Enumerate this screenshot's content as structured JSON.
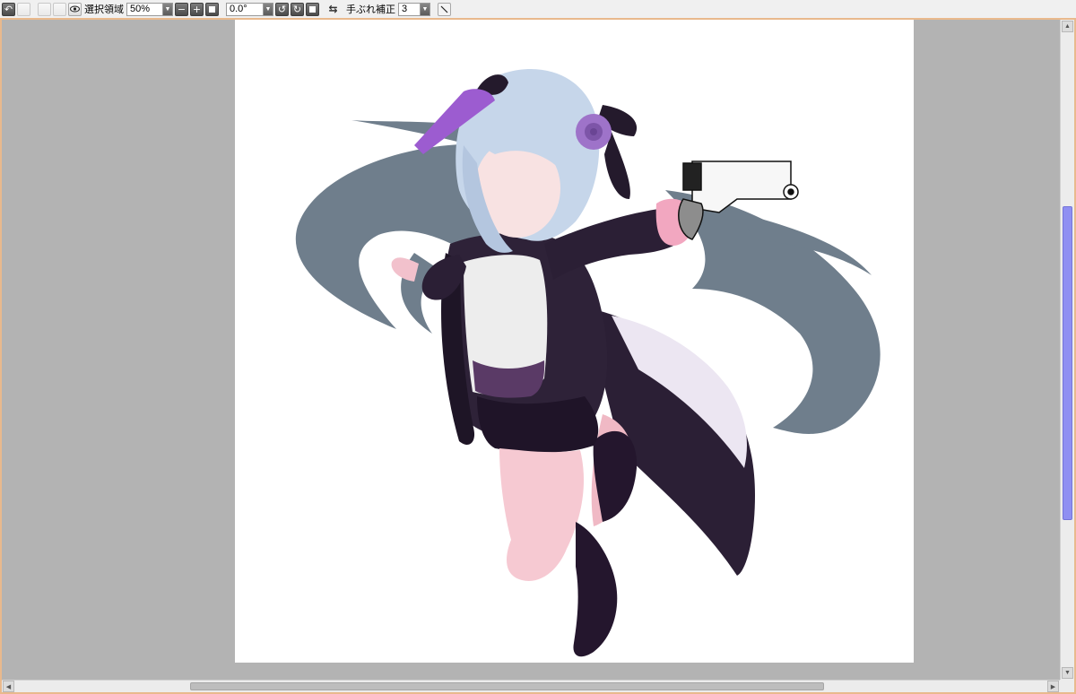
{
  "toolbar": {
    "undo_icon": "undo-icon",
    "redo_icon": "redo-icon",
    "eye_icon": "eye-icon",
    "selection_label": "選択領域",
    "zoom_value": "50%",
    "rotation_value": "0.0°",
    "flip_icon": "flip-horizontal-icon",
    "stabilizer_label": "手ぶれ補正",
    "stabilizer_value": "3",
    "pen_icon": "pen-icon"
  },
  "colors": {
    "workspace_border": "#e9b98d",
    "workspace_bg": "#b3b3b3",
    "paper_bg": "#ffffff",
    "scrollbar_thumb": "#8f8ff2"
  },
  "canvas": {
    "artwork": "illustration-girl-with-revolver"
  }
}
